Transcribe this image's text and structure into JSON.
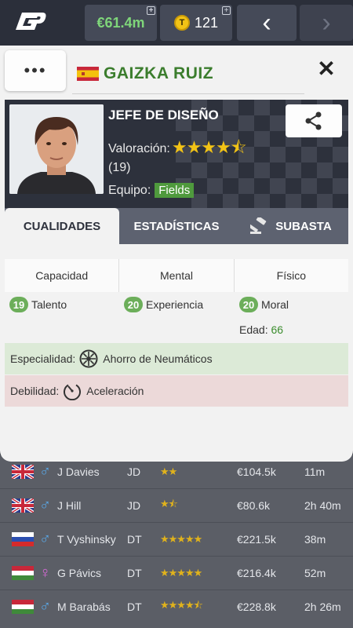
{
  "topbar": {
    "money": "€61.4m",
    "tokens": "121",
    "token_symbol": "T",
    "plus": "+",
    "back": "‹",
    "forward": "›"
  },
  "modal": {
    "more": "•••",
    "name": "GAIZKA RUIZ",
    "close": "✕",
    "job": "JEFE DE DISEÑO",
    "rating_label": "Valoración:",
    "rating_stars": "★★★★⯪",
    "rating_count": "(19)",
    "team_label": "Equipo:",
    "team": "Fields",
    "tabs": [
      "CUALIDADES",
      "ESTADÍSTICAS",
      "SUBASTA"
    ],
    "qualities": {
      "headers": [
        "Capacidad",
        "Mental",
        "Físico"
      ],
      "items": [
        {
          "value": "19",
          "label": "Talento"
        },
        {
          "value": "20",
          "label": "Experiencia"
        },
        {
          "value": "20",
          "label": "Moral"
        }
      ],
      "age_label": "Edad:",
      "age": "66",
      "specialty_label": "Especialidad:",
      "specialty": "Ahorro de Neumáticos",
      "weakness_label": "Debilidad:",
      "weakness": "Aceleración"
    }
  },
  "list": [
    {
      "flag": "uk",
      "gender": "♂",
      "name": "J Davies",
      "role": "JD",
      "stars": "★★",
      "price": "€104.5k",
      "time": "11m"
    },
    {
      "flag": "uk",
      "gender": "♂",
      "name": "J Hill",
      "role": "JD",
      "stars": "★⯪",
      "price": "€80.6k",
      "time": "2h 40m"
    },
    {
      "flag": "ru",
      "gender": "♂",
      "name": "T Vyshinsky",
      "role": "DT",
      "stars": "★★★★★",
      "price": "€221.5k",
      "time": "38m"
    },
    {
      "flag": "hu",
      "gender": "♀",
      "name": "G Pávics",
      "role": "DT",
      "stars": "★★★★★",
      "price": "€216.4k",
      "time": "52m"
    },
    {
      "flag": "hu",
      "gender": "♂",
      "name": "M Barabás",
      "role": "DT",
      "stars": "★★★★⯪",
      "price": "€228.8k",
      "time": "2h 26m"
    }
  ],
  "colors": {
    "accent_green": "#3b7d2d",
    "badge_green": "#4f9a3d",
    "star_gold": "#f2c316"
  }
}
